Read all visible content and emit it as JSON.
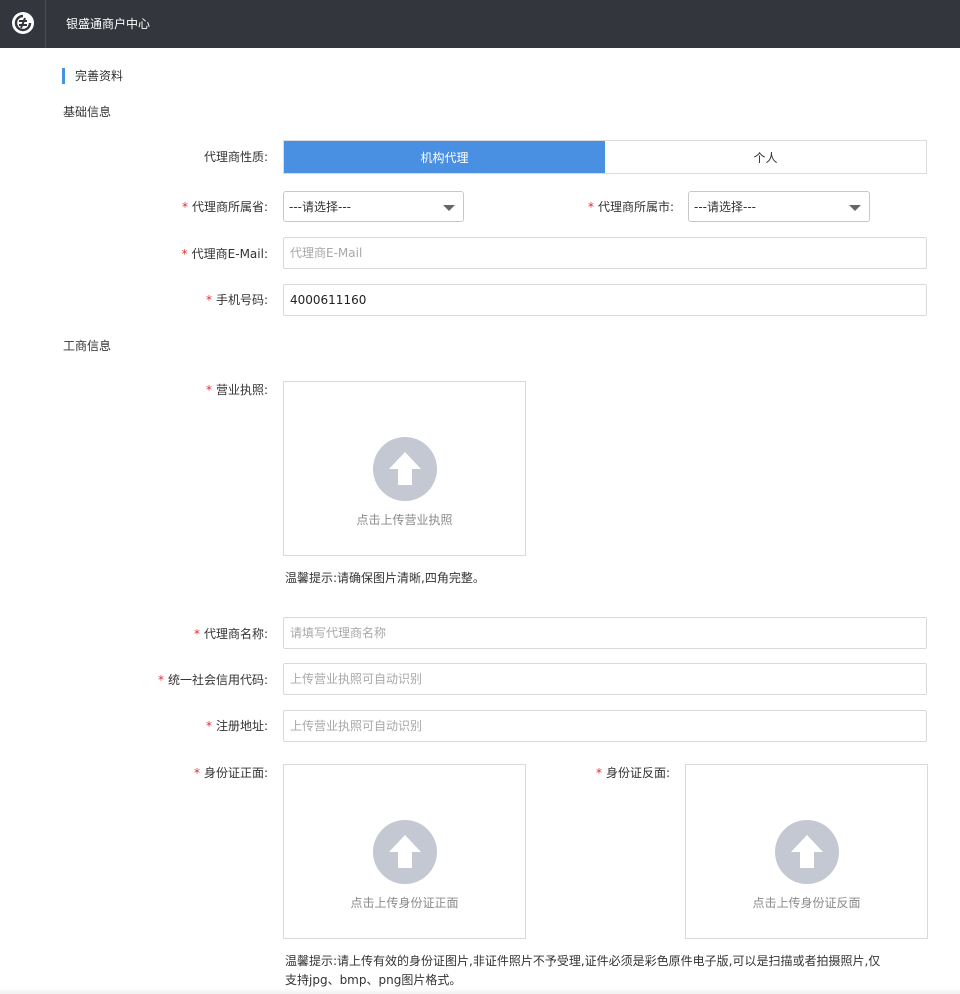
{
  "header": {
    "app_title": "银盛通商户中心",
    "logo_icon": "logo-icon"
  },
  "page": {
    "section_title": "完善资料",
    "accent_color": "#4a90e2"
  },
  "basic_info": {
    "group_title": "基础信息",
    "agent_type": {
      "label": "代理商性质:",
      "options": [
        "机构代理",
        "个人"
      ],
      "selected": "机构代理"
    },
    "province": {
      "required": "*",
      "label": "代理商所属省:",
      "value": "---请选择---"
    },
    "city": {
      "required": "*",
      "label": "代理商所属市:",
      "value": "---请选择---"
    },
    "email": {
      "required": "*",
      "label": "代理商E-Mail:",
      "placeholder": "代理商E-Mail",
      "value": ""
    },
    "phone": {
      "required": "*",
      "label": "手机号码:",
      "value": "4000611160"
    }
  },
  "business_info": {
    "group_title": "工商信息",
    "license": {
      "required": "*",
      "label": "营业执照:",
      "upload_text": "点击上传营业执照",
      "tip": "温馨提示:请确保图片清晰,四角完整。"
    },
    "agent_name": {
      "required": "*",
      "label": "代理商名称:",
      "placeholder": "请填写代理商名称"
    },
    "credit_code": {
      "required": "*",
      "label": "统一社会信用代码:",
      "placeholder": "上传营业执照可自动识别"
    },
    "address": {
      "required": "*",
      "label": "注册地址:",
      "placeholder": "上传营业执照可自动识别"
    },
    "id_front": {
      "required": "*",
      "label": "身份证正面:",
      "upload_text": "点击上传身份证正面"
    },
    "id_back": {
      "required": "*",
      "label": "身份证反面:",
      "upload_text": "点击上传身份证反面"
    },
    "id_tip_line1": "温馨提示:请上传有效的身份证图片,非证件照片不予受理,证件必须是彩色原件电子版,可以是扫描或者拍摄照片,仅",
    "id_tip_line2": "支持jpg、bmp、png图片格式。"
  },
  "icons": {
    "upload": "upload-arrow-icon",
    "dropdown": "chevron-down-icon"
  }
}
